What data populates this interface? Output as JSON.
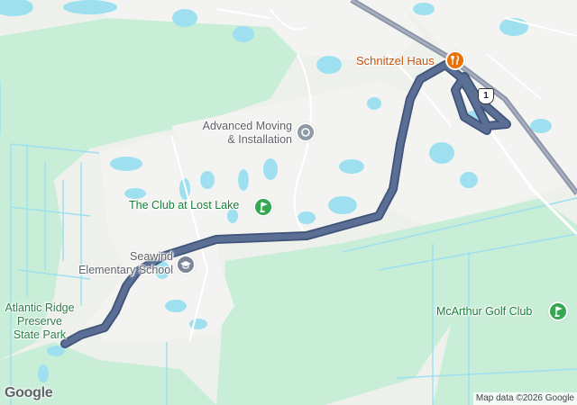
{
  "map": {
    "places": {
      "schnitzel_haus": "Schnitzel Haus",
      "advanced_moving": "Advanced Moving\n& Installation",
      "club_lost_lake": "The Club at Lost Lake",
      "seawind_school": "Seawind\nElementary School",
      "atlantic_ridge": "Atlantic Ridge\nPreserve\nState Park",
      "mcarthur_golf": "McArthur Golf Club"
    },
    "route_shield": "1",
    "colors": {
      "route": "#5b6f95",
      "route_outline": "#3f5278",
      "water": "#9fe0f0",
      "park": "#c9eed8",
      "land": "#eef0ec",
      "highway": "#8a93a6",
      "restaurant": "#e8710a",
      "golf": "#34a853",
      "poi_generic": "#8e9aa6",
      "school": "#7a8595"
    },
    "icons": {
      "schnitzel_haus": "fork-knife-icon",
      "advanced_moving": "generic-poi-icon",
      "club_lost_lake": "golf-icon",
      "seawind_school": "school-icon",
      "mcarthur_golf": "golf-icon"
    },
    "attribution": "Map data ©2026 Google",
    "logo": "Google"
  }
}
